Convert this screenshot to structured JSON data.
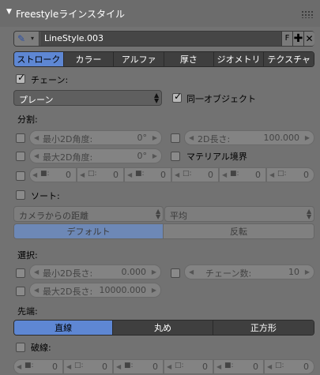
{
  "panel": {
    "title": "Freestyleラインスタイル"
  },
  "linestyle": {
    "name": "LineStyle.003",
    "fake_user": "F"
  },
  "tabs": [
    "ストローク",
    "カラー",
    "アルファ",
    "厚さ",
    "ジオメトリ",
    "テクスチャ"
  ],
  "active_tab": 0,
  "chain": {
    "label": "チェーン:",
    "checked": true,
    "mode": "プレーン",
    "same_object_label": "同一オブジェクト",
    "same_object_checked": true
  },
  "split": {
    "heading": "分割:",
    "min2d_angle": {
      "label": "最小2D角度:",
      "value": "0°"
    },
    "max2d_angle": {
      "label": "最大2D角度:",
      "value": "0°"
    },
    "length2d": {
      "label": "2D長さ:",
      "value": "100.000"
    },
    "material_boundary": "マテリアル境界",
    "pattern": [
      {
        "k": "■:",
        "v": "0"
      },
      {
        "k": "□:",
        "v": "0"
      },
      {
        "k": "■:",
        "v": "0"
      },
      {
        "k": "□:",
        "v": "0"
      },
      {
        "k": "■:",
        "v": "0"
      },
      {
        "k": "□:",
        "v": "0"
      }
    ]
  },
  "sort": {
    "label": "ソート:",
    "key": "カメラからの距離",
    "func": "平均",
    "order": [
      "デフォルト",
      "反転"
    ],
    "order_active": 0
  },
  "select": {
    "heading": "選択:",
    "min2d_length": {
      "label": "最小2D長さ:",
      "value": "0.000"
    },
    "max2d_length": {
      "label": "最大2D長さ:",
      "value": "10000.000"
    },
    "chain_count": {
      "label": "チェーン数:",
      "value": "10"
    }
  },
  "caps": {
    "heading": "先端:",
    "options": [
      "直線",
      "丸め",
      "正方形"
    ],
    "active": 0
  },
  "dashed": {
    "label": "破線:",
    "pattern": [
      {
        "k": "■:",
        "v": "0"
      },
      {
        "k": "□:",
        "v": "0"
      },
      {
        "k": "■:",
        "v": "0"
      },
      {
        "k": "□:",
        "v": "0"
      },
      {
        "k": "■:",
        "v": "0"
      },
      {
        "k": "□:",
        "v": "0"
      }
    ]
  }
}
